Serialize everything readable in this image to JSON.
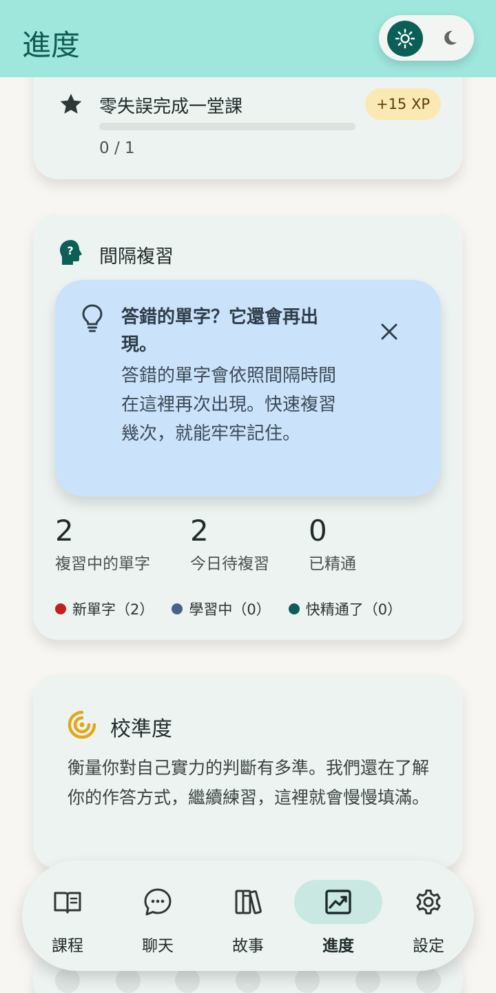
{
  "header": {
    "title": "進度"
  },
  "theme": {
    "light_icon": "sun-icon",
    "dark_icon": "moon-icon"
  },
  "quest": {
    "title": "零失誤完成一堂課",
    "xp": "+15 XP",
    "progress_text": "0 / 1",
    "progress_fraction": 0
  },
  "review": {
    "title": "間隔複習",
    "tip": {
      "title": "答錯的單字？它還會再出現。",
      "body": "答錯的單字會依照間隔時間在這裡再次出現。快速複習幾次，就能牢牢記住。"
    },
    "stats": [
      {
        "value": "2",
        "label": "複習中的單字"
      },
      {
        "value": "2",
        "label": "今日待複習"
      },
      {
        "value": "0",
        "label": "已精通"
      }
    ],
    "legend": [
      {
        "label": "新單字（2）",
        "color": "#c41f1f"
      },
      {
        "label": "學習中（0）",
        "color": "#4a6288"
      },
      {
        "label": "快精通了（0）",
        "color": "#0b5f57"
      }
    ]
  },
  "calibration": {
    "title": "校準度",
    "description": "衡量你對自己實力的判斷有多準。我們還在了解你的作答方式，繼續練習，這裡就會慢慢填滿。"
  },
  "nav": {
    "items": [
      {
        "label": "課程",
        "icon": "book-icon",
        "active": false
      },
      {
        "label": "聊天",
        "icon": "chat-bubble-icon",
        "active": false
      },
      {
        "label": "故事",
        "icon": "books-icon",
        "active": false
      },
      {
        "label": "進度",
        "icon": "chart-icon",
        "active": true
      },
      {
        "label": "設定",
        "icon": "gear-icon",
        "active": false
      }
    ]
  }
}
